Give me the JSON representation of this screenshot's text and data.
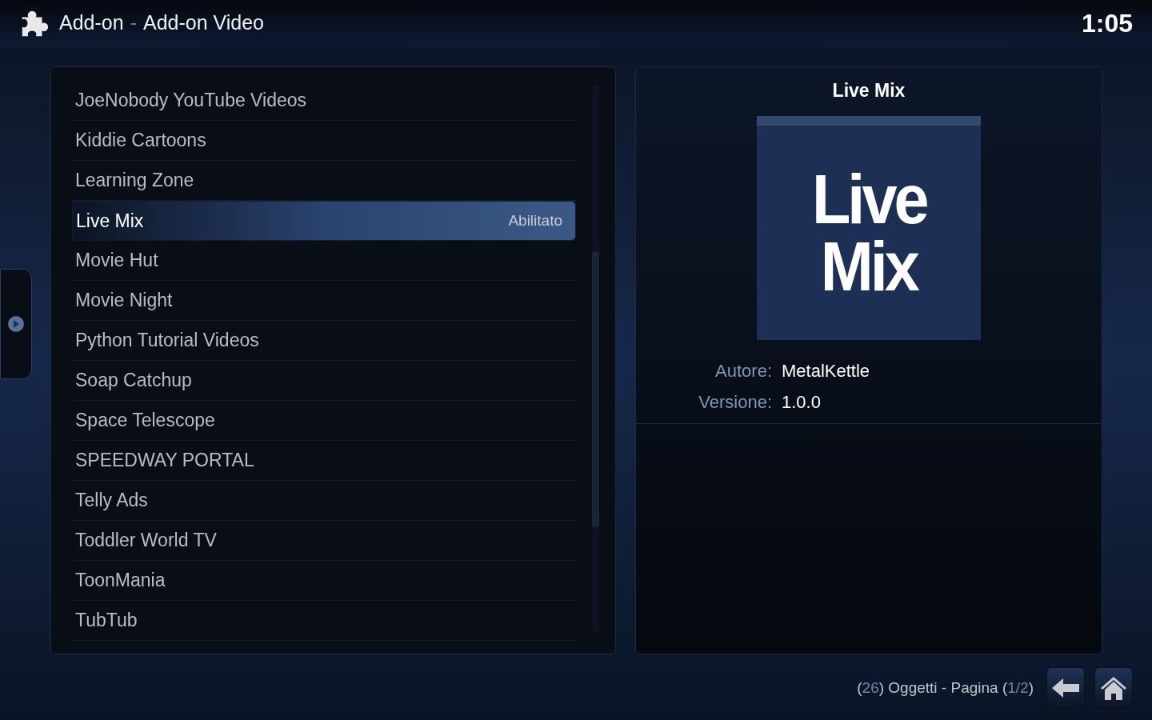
{
  "header": {
    "section": "Add-on",
    "separator": "-",
    "title": "Add-on Video",
    "clock": "1:05"
  },
  "list": {
    "items": [
      {
        "label": "JoeNobody YouTube Videos",
        "selected": false
      },
      {
        "label": "Kiddie Cartoons",
        "selected": false
      },
      {
        "label": "Learning Zone",
        "selected": false
      },
      {
        "label": "Live Mix",
        "selected": true,
        "status": "Abilitato"
      },
      {
        "label": "Movie Hut",
        "selected": false
      },
      {
        "label": "Movie Night",
        "selected": false
      },
      {
        "label": "Python Tutorial Videos",
        "selected": false
      },
      {
        "label": "Soap Catchup",
        "selected": false
      },
      {
        "label": "Space Telescope",
        "selected": false
      },
      {
        "label": "SPEEDWAY PORTAL",
        "selected": false
      },
      {
        "label": "Telly Ads",
        "selected": false
      },
      {
        "label": "Toddler World TV",
        "selected": false
      },
      {
        "label": "ToonMania",
        "selected": false
      },
      {
        "label": "TubTub",
        "selected": false
      }
    ]
  },
  "details": {
    "title": "Live Mix",
    "thumbnail": {
      "lines": [
        "Live",
        "Mix"
      ]
    },
    "info": [
      {
        "label": "Autore:",
        "value": "MetalKettle"
      },
      {
        "label": "Versione:",
        "value": "1.0.0"
      }
    ]
  },
  "footer": {
    "parts": [
      {
        "text": "(",
        "accent": false
      },
      {
        "text": "26",
        "accent": true
      },
      {
        "text": ") Oggetti - Pagina (",
        "accent": false
      },
      {
        "text": "1/2",
        "accent": true
      },
      {
        "text": ")",
        "accent": false
      }
    ]
  }
}
